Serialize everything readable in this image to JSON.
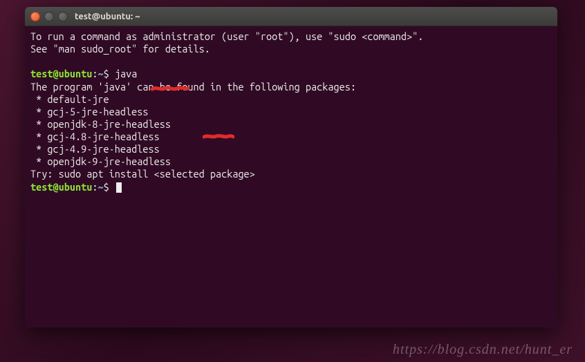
{
  "window": {
    "title": "test@ubuntu: ~"
  },
  "terminal": {
    "intro_line1": "To run a command as administrator (user \"root\"), use \"sudo <command>\".",
    "intro_line2": "See \"man sudo_root\" for details.",
    "prompt_user": "test@ubuntu",
    "prompt_sep1": ":",
    "prompt_path": "~",
    "prompt_sep2": "$",
    "command1": "java",
    "output_header": "The program 'java' can be found in the following packages:",
    "packages": [
      " * default-jre",
      " * gcj-5-jre-headless",
      " * openjdk-8-jre-headless",
      " * gcj-4.8-jre-headless",
      " * gcj-4.9-jre-headless",
      " * openjdk-9-jre-headless"
    ],
    "output_try": "Try: sudo apt install <selected package>"
  },
  "annotations": {
    "color": "#e22b2b"
  },
  "watermark": "https://blog.csdn.net/hunt_er"
}
